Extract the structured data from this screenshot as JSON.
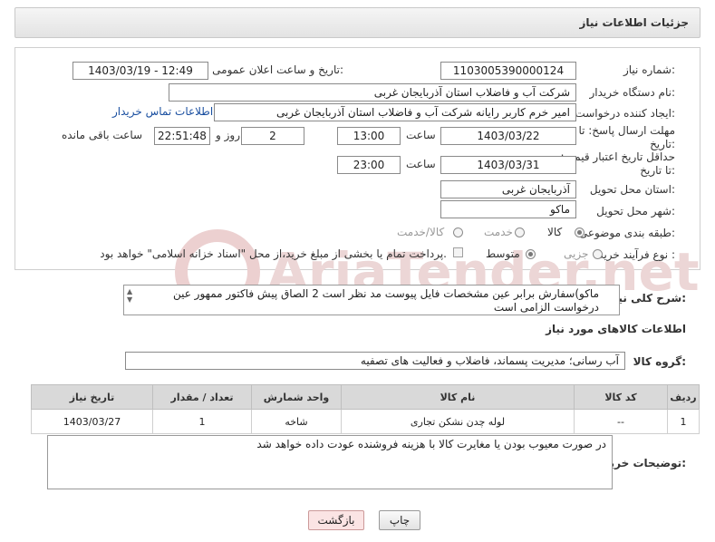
{
  "header": {
    "title": "جزئیات اطلاعات نیاز"
  },
  "form": {
    "need_number_label": "شماره نیاز:",
    "need_number": "1103005390000124",
    "announce_label": "تاریخ و ساعت اعلان عمومی:",
    "announce_value": "1403/03/19 - 12:49",
    "buyer_org_label": "نام دستگاه خریدار:",
    "buyer_org": "شرکت آب و فاضلاب استان آذربایجان غربی",
    "creator_label": "ایجاد کننده درخواست:",
    "creator": "امیر خرم کاربر رایانه شرکت آب و فاضلاب استان آذربایجان غربی",
    "buyer_contact_link": "اطلاعات تماس خریدار",
    "deadline_label": "مهلت ارسال پاسخ: تا تاریخ:",
    "deadline_date": "1403/03/22",
    "time_label": "ساعت",
    "deadline_time": "13:00",
    "days_value": "2",
    "days_label": "روز و",
    "remaining_time": "22:51:48",
    "remaining_label": "ساعت باقی مانده",
    "price_validity_label": "حداقل تاریخ اعتبار قیمت: تا تاریخ:",
    "price_validity_date": "1403/03/31",
    "price_validity_time": "23:00",
    "province_label": "استان محل تحویل:",
    "province": "آذربایجان غربی",
    "city_label": "شهر محل تحویل:",
    "city": "ماکو",
    "category_label": "طبقه بندی موضوعی:",
    "category_options": [
      "کالا",
      "خدمت",
      "کالا/خدمت"
    ],
    "process_label": "نوع فرآیند خرید :",
    "process_options": [
      "جزیی",
      "متوسط"
    ],
    "payment_note": "پرداخت تمام یا بخشی از مبلغ خرید،از محل \"اسناد خزانه اسلامی\" خواهد بود."
  },
  "description": {
    "label": "شرح کلی نیاز:",
    "text": "ماکو)سفارش برابر عین مشخصات فایل پیوست مد نظر است 2 الصاق پیش فاکتور ممهور عین درخواست الزامی است"
  },
  "goods_section": {
    "title": "اطلاعات کالاهای مورد نیاز",
    "group_label": "گروه کالا:",
    "group_value": "آب رسانی؛ مدیریت پسماند، فاضلاب و فعالیت های تصفیه"
  },
  "table": {
    "headers": [
      "ردیف",
      "کد کالا",
      "نام کالا",
      "واحد شمارش",
      "تعداد / مقدار",
      "تاریخ نیاز"
    ],
    "rows": [
      [
        "1",
        "--",
        "لوله چدن نشکن تجاری",
        "شاخه",
        "1",
        "1403/03/27"
      ]
    ]
  },
  "buyer_notes": {
    "label": "توضیحات خریدار:",
    "text": "در صورت معیوب بودن یا مغایرت کالا با هزینه فروشنده عودت داده خواهد شد"
  },
  "buttons": {
    "print": "چاپ",
    "back": "بازگشت"
  },
  "watermark": {
    "text": "AriaTender.net"
  },
  "colors": {
    "link": "#1a4fa0",
    "watermark": "#e8c6c6",
    "table_header": "#d9d9d9"
  }
}
